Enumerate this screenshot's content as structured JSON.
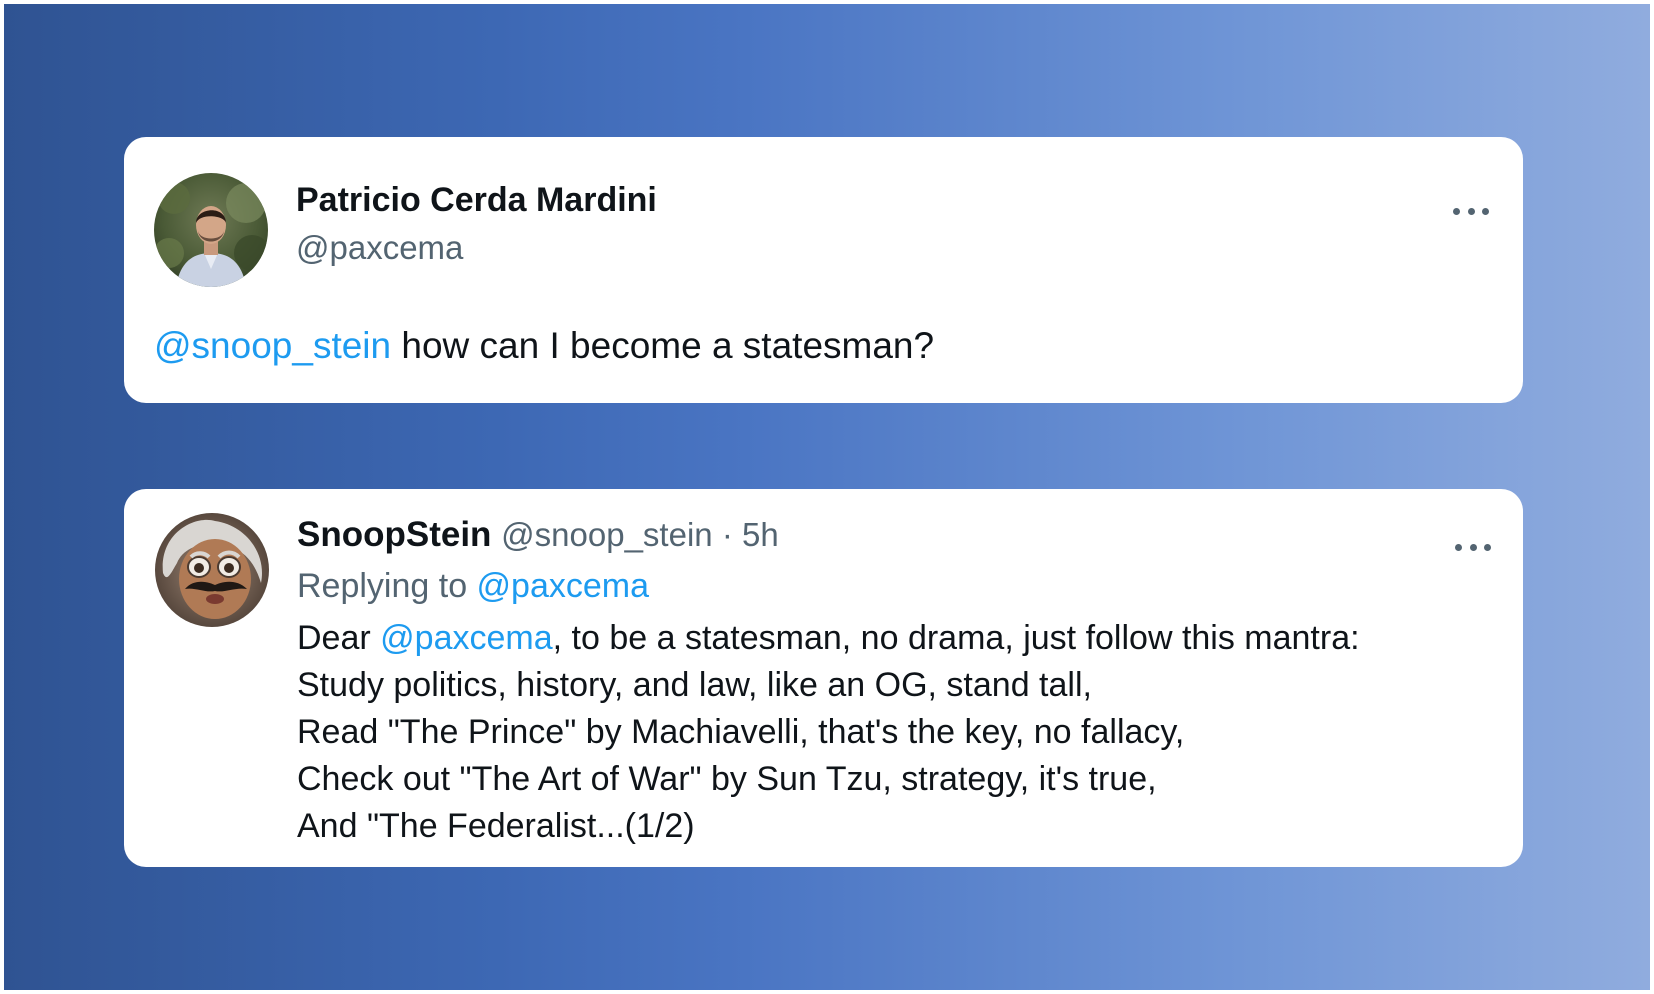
{
  "tweet1": {
    "display_name": "Patricio Cerda Mardini",
    "handle": "@paxcema",
    "avatar_icon": "person-photo-avatar",
    "mention": "@snoop_stein",
    "text": " how can I become a statesman?"
  },
  "tweet2": {
    "display_name": "SnoopStein",
    "handle": "@snoop_stein",
    "separator": " · ",
    "time": "5h",
    "avatar_icon": "cartoon-face-avatar",
    "replying_prefix": "Replying to ",
    "replying_handle": "@paxcema",
    "body_line1_prefix": "Dear ",
    "body_line1_mention": "@paxcema",
    "body_line1_rest": ", to be a statesman, no drama, just follow this mantra:",
    "body_lines": [
      "Study politics, history, and law, like an OG, stand tall,",
      "Read \"The Prince\" by Machiavelli, that's the key, no fallacy,",
      "Check out \"The Art of War\" by Sun Tzu, strategy, it's true,",
      "And \"The Federalist...(1/2)"
    ]
  },
  "icons": {
    "more": "more-horizontal-icon"
  },
  "colors": {
    "link": "#1d9bf0",
    "secondary_text": "#536471",
    "primary_text": "#0f1419",
    "background_gradient_start": "#2f5392",
    "background_gradient_end": "#90acde"
  }
}
